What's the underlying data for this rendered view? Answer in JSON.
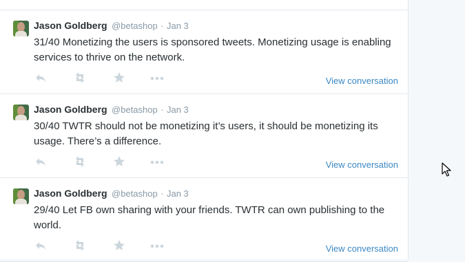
{
  "tweets": [
    {
      "name": "Jason Goldberg",
      "handle": "@betashop",
      "separator": "·",
      "date": "Jan 3",
      "text": "31/40 Monetizing the users is sponsored tweets. Monetizing usage is enabling services to thrive on the network.",
      "view_conversation": "View conversation"
    },
    {
      "name": "Jason Goldberg",
      "handle": "@betashop",
      "separator": "·",
      "date": "Jan 3",
      "text": "30/40 TWTR should not be monetizing it’s users, it should be monetizing its usage. There’s a difference.",
      "view_conversation": "View conversation"
    },
    {
      "name": "Jason Goldberg",
      "handle": "@betashop",
      "separator": "·",
      "date": "Jan 3",
      "text": "29/40 Let FB own sharing with your friends. TWTR can own publishing to the world.",
      "view_conversation": "View conversation"
    }
  ],
  "icons": {
    "reply": "reply-icon",
    "retweet": "retweet-icon",
    "favorite": "star-icon",
    "more": "more-dots-icon",
    "cursor": "mouse-pointer-icon"
  },
  "colors": {
    "action_icon": "#ccd6dd",
    "link": "#3b88c3",
    "text": "#292f33",
    "meta": "#8899a6",
    "divider": "#e1e8ed"
  }
}
